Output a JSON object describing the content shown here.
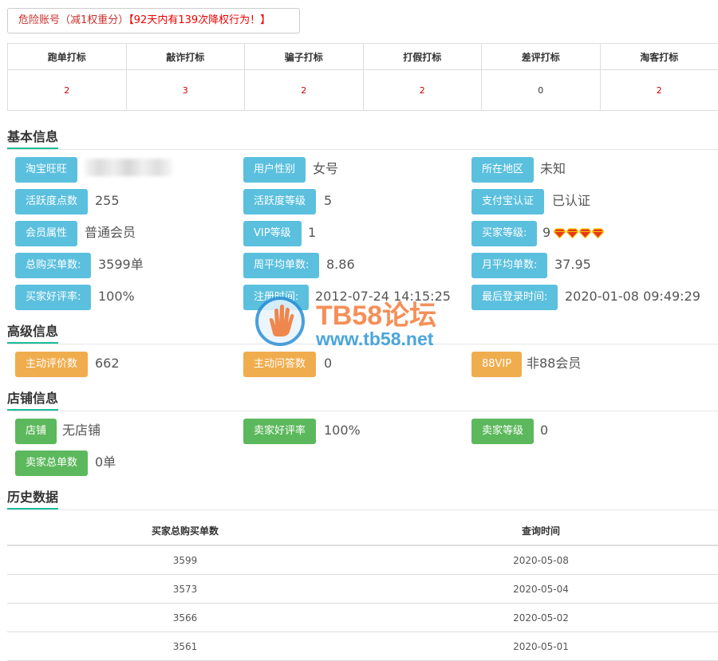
{
  "alert": {
    "part1": "危险账号（减1权重分）",
    "part2": "【92天内有139次降权行为！】"
  },
  "flags": {
    "headers": [
      "跑单打标",
      "敲诈打标",
      "骗子打标",
      "打假打标",
      "差评打标",
      "淘客打标"
    ],
    "values": [
      "2",
      "3",
      "2",
      "2",
      "0",
      "2"
    ]
  },
  "basic": {
    "title": "基本信息",
    "rows": [
      [
        {
          "label": "淘宝旺旺",
          "value": ""
        },
        {
          "label": "用户性别",
          "value": "女号"
        },
        {
          "label": "所在地区",
          "value": "未知"
        }
      ],
      [
        {
          "label": "活跃度点数",
          "value": "255"
        },
        {
          "label": "活跃度等级",
          "value": "5"
        },
        {
          "label": "支付宝认证",
          "value": "已认证"
        }
      ],
      [
        {
          "label": "会员属性",
          "value": "普通会员"
        },
        {
          "label": "VIP等级",
          "value": "1"
        },
        {
          "label": "买家等级:",
          "value": "9"
        }
      ],
      [
        {
          "label": "总购买单数:",
          "value": "3599单"
        },
        {
          "label": "周平均单数:",
          "value": "8.86"
        },
        {
          "label": "月平均单数:",
          "value": "37.95"
        }
      ],
      [
        {
          "label": "买家好评率:",
          "value": "100%"
        },
        {
          "label": "注册时间:",
          "value": "2012-07-24 14:15:25"
        },
        {
          "label": "最后登录时间:",
          "value": "2020-01-08 09:49:29"
        }
      ]
    ],
    "buyer_level_icon": "diamond-icon",
    "buyer_level_icon_count": 4
  },
  "advanced": {
    "title": "高级信息",
    "items": [
      {
        "label": "主动评价数",
        "value": "662"
      },
      {
        "label": "主动问答数",
        "value": "0"
      },
      {
        "label": "88VIP",
        "value": "非88会员"
      }
    ]
  },
  "shop": {
    "title": "店铺信息",
    "items": [
      {
        "label": "店铺",
        "value": "无店铺"
      },
      {
        "label": "卖家好评率",
        "value": "100%"
      },
      {
        "label": "卖家等级",
        "value": "0"
      },
      {
        "label": "卖家总单数",
        "value": "0单"
      }
    ]
  },
  "history": {
    "title": "历史数据",
    "headers": [
      "买家总购买单数",
      "查询时间"
    ],
    "rows": [
      [
        "3599",
        "2020-05-08"
      ],
      [
        "3573",
        "2020-05-04"
      ],
      [
        "3566",
        "2020-05-02"
      ],
      [
        "3561",
        "2020-05-01"
      ]
    ]
  },
  "watermark": {
    "title": "TB58论坛",
    "url": "www.tb58.net"
  },
  "colors": {
    "accent": "#1abc9c",
    "tag_blue": "#5bc0de",
    "tag_orange": "#f0ad4e",
    "tag_green": "#5cb85c",
    "alert_red": "#e00000"
  }
}
